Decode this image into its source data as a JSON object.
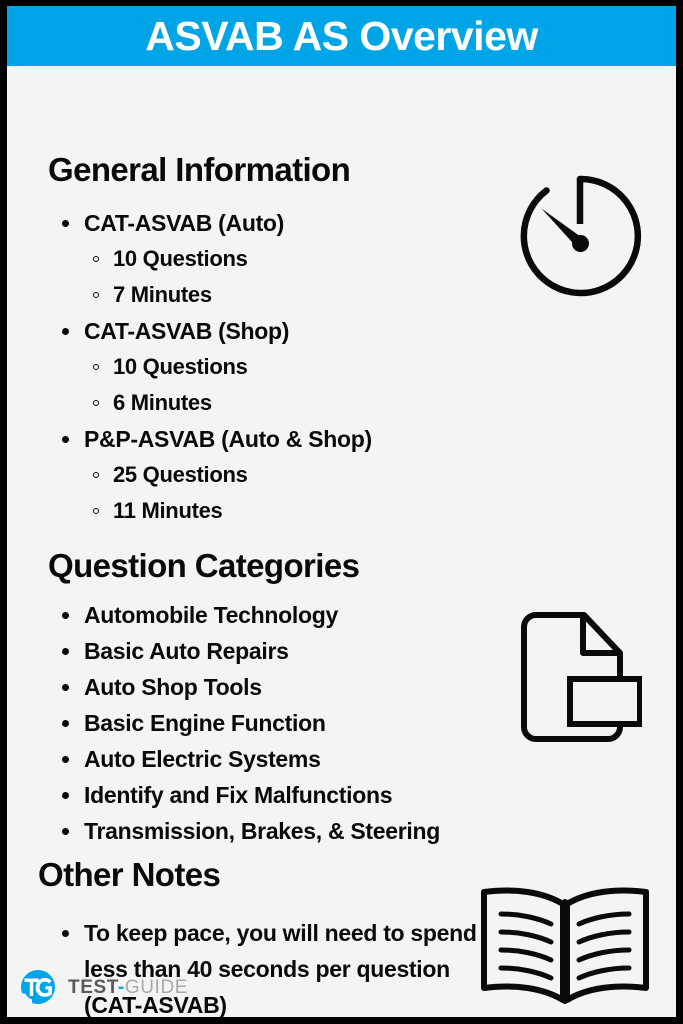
{
  "header": {
    "title": "ASVAB AS Overview",
    "background_color": "#00a5e8",
    "text_color": "#ffffff"
  },
  "page": {
    "background_color": "#f4f4f4",
    "border_color": "#000000",
    "text_color": "#0a0a0a"
  },
  "sections": {
    "general_information": {
      "heading": "General Information",
      "icon": "timer-icon",
      "items": [
        {
          "label": "CAT-ASVAB (Auto)",
          "sub": [
            "10 Questions",
            "7 Minutes"
          ]
        },
        {
          "label": "CAT-ASVAB (Shop)",
          "sub": [
            "10 Questions",
            "6 Minutes"
          ]
        },
        {
          "label": "P&P-ASVAB (Auto & Shop)",
          "sub": [
            "25 Questions",
            "11 Minutes"
          ]
        }
      ]
    },
    "question_categories": {
      "heading": "Question Categories",
      "icon": "document-icon",
      "items": [
        "Automobile Technology",
        "Basic Auto Repairs",
        "Auto Shop Tools",
        "Basic Engine Function",
        "Auto Electric Systems",
        "Identify and Fix Malfunctions",
        "Transmission, Brakes,  & Steering"
      ]
    },
    "other_notes": {
      "heading": "Other Notes",
      "icon": "open-book-icon",
      "items": [
        "To keep pace, you will need to spend less than 40 seconds per question (CAT-ASVAB)"
      ]
    }
  },
  "footer": {
    "logo_icon": "test-guide-logo-icon",
    "wordmark_primary": "TEST",
    "wordmark_dash": "-",
    "wordmark_secondary": "GUIDE",
    "brand_color": "#00a5e8"
  }
}
